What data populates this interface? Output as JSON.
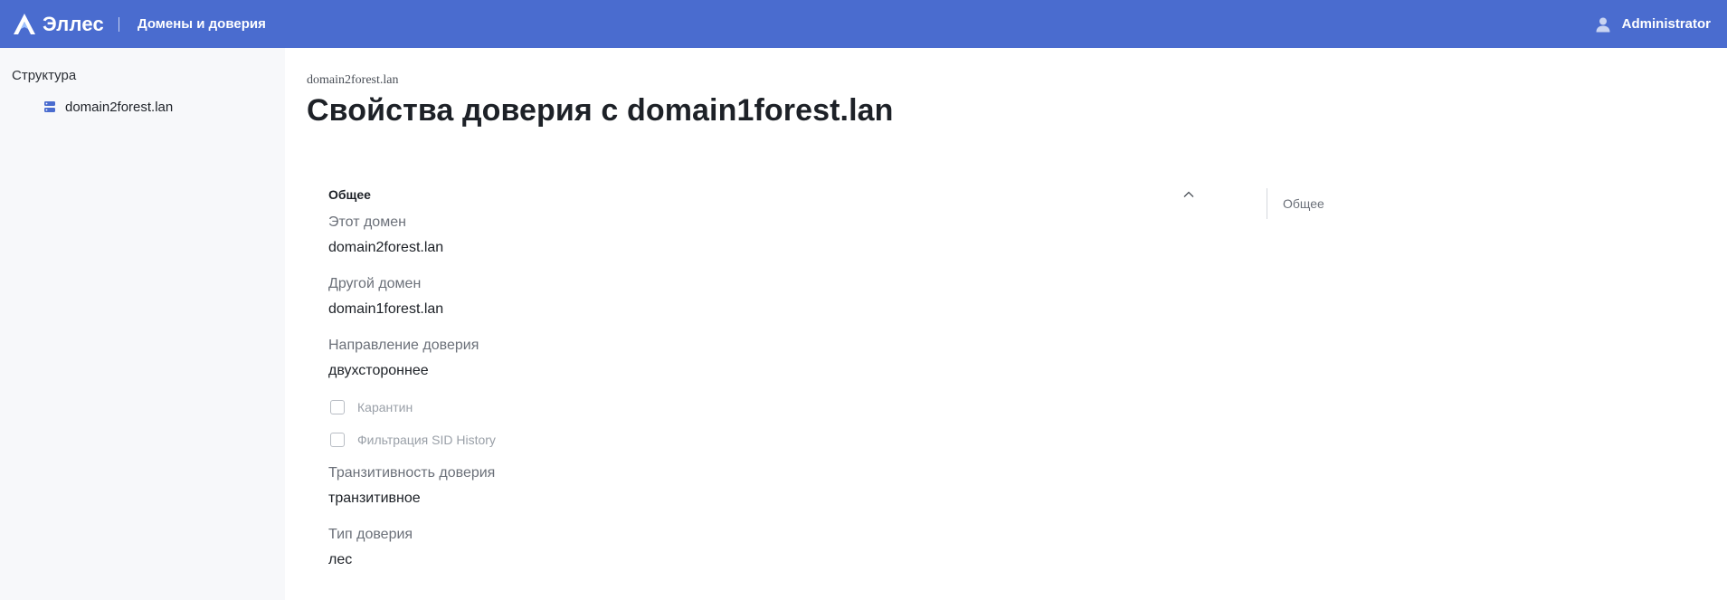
{
  "header": {
    "app_name": "Эллес",
    "section_title": "Домены и доверия",
    "user_name": "Administrator",
    "brand_color": "#4a6ccf"
  },
  "sidebar": {
    "heading": "Структура",
    "items": [
      {
        "label": "domain2forest.lan",
        "icon": "server-icon"
      }
    ]
  },
  "main": {
    "breadcrumb": "domain2forest.lan",
    "title": "Свойства доверия с domain1forest.lan",
    "card": {
      "title": "Общее",
      "fields": [
        {
          "label": "Этот домен",
          "value": "domain2forest.lan"
        },
        {
          "label": "Другой домен",
          "value": "domain1forest.lan"
        },
        {
          "label": "Направление доверия",
          "value": "двухстороннее"
        },
        {
          "label": "Транзитивность доверия",
          "value": "транзитивное"
        },
        {
          "label": "Тип доверия",
          "value": "лес"
        }
      ],
      "checkboxes": [
        {
          "label": "Карантин",
          "checked": false
        },
        {
          "label": "Фильтрация SID History",
          "checked": false
        }
      ]
    },
    "toc": {
      "items": [
        "Общее"
      ]
    }
  }
}
